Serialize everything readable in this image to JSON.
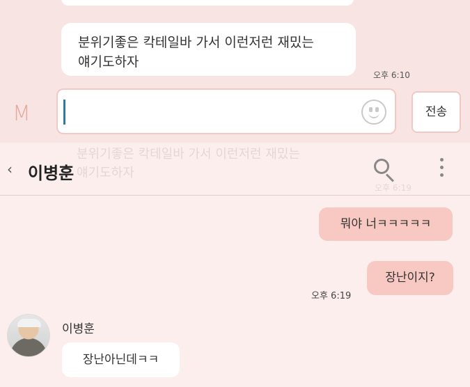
{
  "top_overlay": {
    "message_text_line1": "분위기좋은 칵테일바 가서 이런저런 재밌는",
    "message_text_line2": "얘기도하자",
    "message_time": "오후 6:10",
    "send_label": "전송",
    "keyboard_icon_label": "M"
  },
  "ghost": {
    "line1": "분위기좋은 칵테일바 가서 이런저런 재밌는",
    "line2": "얘기도하자",
    "time": "오후 6:19"
  },
  "header": {
    "back_symbol": "‹",
    "contact_name": "이병훈"
  },
  "messages": {
    "sent_1": "뭐야 너ㅋㅋㅋㅋㅋ",
    "sent_2": "장난이지?",
    "sent_time": "오후 6:19",
    "received_sender": "이병훈",
    "received_1": "장난아닌데ㅋㅋ"
  },
  "colors": {
    "sent_bubble": "#f7c9c2",
    "background": "#fbeeed",
    "input_border": "#f0c9c4",
    "caret": "#2a7ea1"
  },
  "icons": [
    "emoji-icon",
    "search-icon",
    "more-icon",
    "back-icon",
    "avatar"
  ]
}
